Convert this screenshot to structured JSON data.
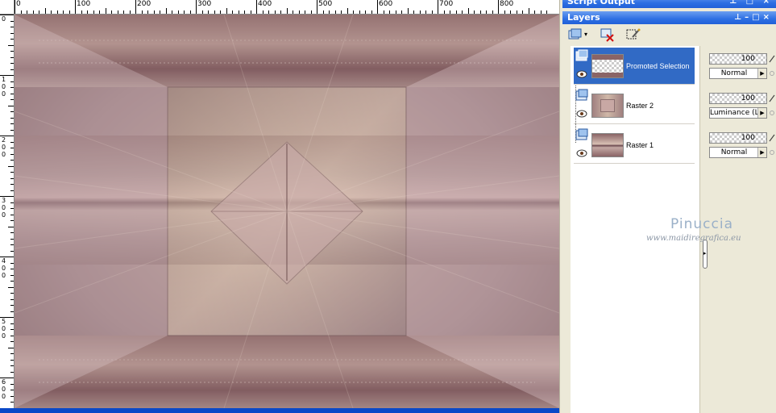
{
  "ruler": {
    "horizontal_labels": [
      "0",
      "100",
      "200",
      "300",
      "400",
      "500",
      "600",
      "700",
      "800"
    ],
    "vertical_labels": [
      "0",
      "100",
      "200",
      "300",
      "400",
      "500",
      "600"
    ]
  },
  "panels": {
    "script_output": {
      "title": "Script Output"
    },
    "layers": {
      "title": "Layers"
    }
  },
  "layers": [
    {
      "name": "Promoted Selection",
      "opacity": "100",
      "blend_mode": "Normal",
      "selected": true
    },
    {
      "name": "Raster 2",
      "opacity": "100",
      "blend_mode": "Luminance (L)",
      "selected": false
    },
    {
      "name": "Raster 1",
      "opacity": "100",
      "blend_mode": "Normal",
      "selected": false
    }
  ],
  "watermark": {
    "name": "Pinuccia",
    "url": "www.maidiregrafica.eu"
  },
  "colors": {
    "accent": "#316ac5",
    "titlebar": "#2d6fe3",
    "canvas_base": "#8a6c6c"
  }
}
